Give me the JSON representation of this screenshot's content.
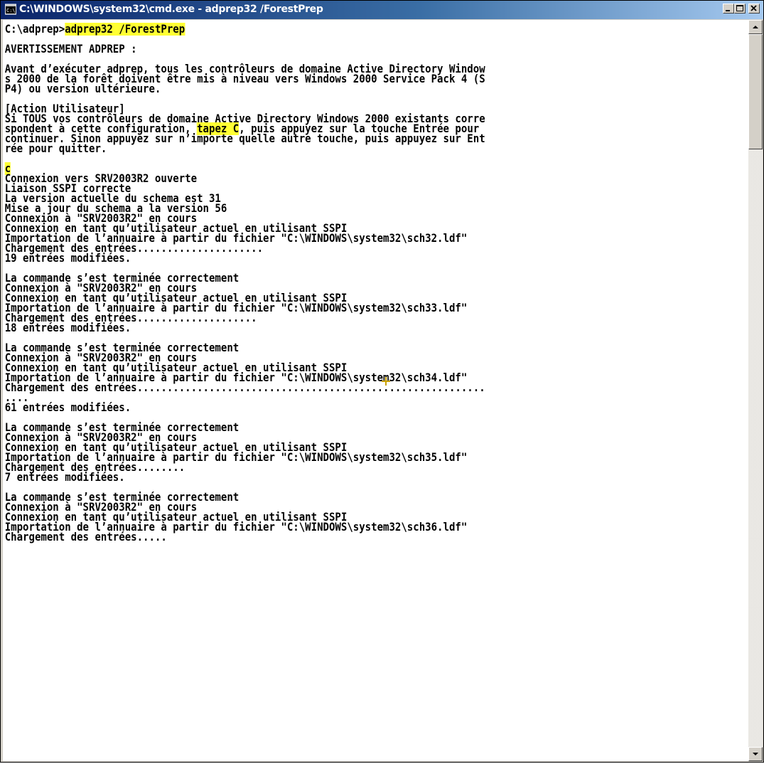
{
  "window": {
    "title": "C:\\WINDOWS\\system32\\cmd.exe - adprep32 /ForestPrep",
    "icon": "cmd-icon"
  },
  "titlebar_buttons": {
    "minimize": "minimize-icon",
    "maximize": "maximize-icon",
    "close": "close-icon"
  },
  "console": {
    "prompt": "C:\\adprep>",
    "command": "adprep32 /ForestPrep",
    "lines_intro": [
      "",
      "AVERTISSEMENT ADPREP :",
      "",
      "Avant d’exécuter adprep, tous les contrôleurs de domaine Active Directory Window",
      "s 2000 de la forêt doivent être mis à niveau vers Windows 2000 Service Pack 4 (S",
      "P4) ou version ultérieure.",
      "",
      "[Action Utilisateur]",
      "Si TOUS vos contrôleurs de domaine Active Directory Windows 2000 existants corre"
    ],
    "action_line_before": "spondent à cette configuration, ",
    "action_highlight": "tapez C",
    "action_line_after": ", puis appuyez sur la touche Entrée pour",
    "lines_action_rest": [
      "continuer. Sinon appuyez sur n’importe quelle autre touche, puis appuyez sur Ent",
      "rée pour quitter.",
      ""
    ],
    "user_input": "c",
    "lines_output": [
      "Connexion vers SRV2003R2 ouverte",
      "Liaison SSPI correcte",
      "La version actuelle du schema est 31",
      "Mise a jour du schema a la version 56",
      "Connexion à \"SRV2003R2\" en cours",
      "Connexion en tant qu’utilisateur actuel en utilisant SSPI",
      "Importation de l’annuaire à partir du fichier \"C:\\WINDOWS\\system32\\sch32.ldf\"",
      "Chargement des entrées.....................",
      "19 entrées modifiées.",
      "",
      "La commande s’est terminée correctement",
      "Connexion à \"SRV2003R2\" en cours",
      "Connexion en tant qu’utilisateur actuel en utilisant SSPI",
      "Importation de l’annuaire à partir du fichier \"C:\\WINDOWS\\system32\\sch33.ldf\"",
      "Chargement des entrées....................",
      "18 entrées modifiées.",
      "",
      "La commande s’est terminée correctement",
      "Connexion à \"SRV2003R2\" en cours",
      "Connexion en tant qu’utilisateur actuel en utilisant SSPI",
      "Importation de l’annuaire à partir du fichier \"C:\\WINDOWS\\system32\\sch34.ldf\"",
      "Chargement des entrées..........................................................",
      "....",
      "61 entrées modifiées.",
      "",
      "La commande s’est terminée correctement",
      "Connexion à \"SRV2003R2\" en cours",
      "Connexion en tant qu’utilisateur actuel en utilisant SSPI",
      "Importation de l’annuaire à partir du fichier \"C:\\WINDOWS\\system32\\sch35.ldf\"",
      "Chargement des entrées........",
      "7 entrées modifiées.",
      "",
      "La commande s’est terminée correctement",
      "Connexion à \"SRV2003R2\" en cours",
      "Connexion en tant qu’utilisateur actuel en utilisant SSPI",
      "Importation de l’annuaire à partir du fichier \"C:\\WINDOWS\\system32\\sch36.ldf\"",
      "Chargement des entrées....."
    ]
  },
  "scrollbar": {
    "up": "scroll-up-arrow-icon",
    "down": "scroll-down-arrow-icon"
  },
  "colors": {
    "highlight": "#ffff33",
    "titlebar_start": "#0a246a",
    "titlebar_end": "#a6caf0"
  }
}
